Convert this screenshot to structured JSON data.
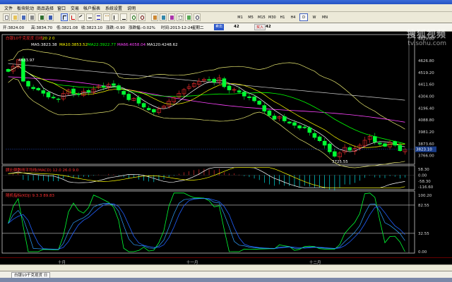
{
  "window": {
    "title": ""
  },
  "menu": [
    "文件",
    "板块轮动",
    "商品选择",
    "窗口",
    "交易",
    "帐户报表",
    "系统设置",
    "说明"
  ],
  "periods": [
    "M1",
    "M5",
    "M15",
    "M30",
    "H1",
    "H4",
    "D",
    "W",
    "MN"
  ],
  "active_period": "D",
  "info": {
    "open": "开:3824.00",
    "high": "高:3834.70",
    "low": "低:3821.08",
    "close": "收:3823.10",
    "change": "涨跌:-0.90",
    "change_pct": "涨跌幅:-0.02%",
    "time": "时间:2013-12-24",
    "weekday": "星期二",
    "bid_label": "卖出",
    "bid": "42",
    "ask_label": "买入",
    "ask": "42"
  },
  "watermark": {
    "main": "搜狐视频",
    "sub": "tv.sohu.com"
  },
  "chart_data": [
    {
      "type": "candlestick",
      "panel": "price",
      "title": "白银10千克现货 日线",
      "params": "20 2 0",
      "legend": [
        {
          "text": "MA5:3823.38",
          "color": "#ffffff"
        },
        {
          "text": "MA10:3853.52",
          "color": "#ffff00"
        },
        {
          "text": "MA22:3922.77",
          "color": "#00ff00"
        },
        {
          "text": "MA66:4058.04",
          "color": "#ff44ff"
        },
        {
          "text": "MA120:4248.62",
          "color": "#ffffff"
        }
      ],
      "y_ticks": [
        "4829.00",
        "4626.80",
        "4519.20",
        "4411.60",
        "4304.00",
        "4196.40",
        "4088.80",
        "3981.20",
        "3873.60",
        "3766.00"
      ],
      "ylim": [
        3700,
        4850
      ],
      "annotations": [
        {
          "text": "4633.97",
          "value": 4634
        },
        {
          "text": "3725.55",
          "value": 3726
        }
      ],
      "current_price_label": "3823.10",
      "close_series": [
        4528,
        4575,
        4634,
        4440,
        4395,
        4372,
        4360,
        4330,
        4296,
        4288,
        4275,
        4330,
        4360,
        4325,
        4318,
        4350,
        4342,
        4370,
        4395,
        4388,
        4410,
        4402,
        4360,
        4320,
        4272,
        4285,
        4240,
        4205,
        4180,
        4160,
        4190,
        4215,
        4260,
        4290,
        4330,
        4365,
        4390,
        4420,
        4440,
        4458,
        4448,
        4432,
        4470,
        4390,
        4360,
        4365,
        4340,
        4305,
        4290,
        4262,
        4230,
        4168,
        4130,
        4095,
        4120,
        4080,
        4060,
        4040,
        4015,
        4018,
        3975,
        3930,
        3900,
        3860,
        3800,
        3760,
        3790,
        3840,
        3815,
        3830,
        3860,
        3905,
        3940,
        3890,
        3870,
        3850,
        3885,
        3860,
        3810,
        3823
      ]
    },
    {
      "type": "bar",
      "panel": "indicator1",
      "title": "顾比倒数线平均线(MACD) 12.0 26.0 9.0",
      "y_ticks": [
        "58.30",
        "0.00",
        "-58.30",
        "-116.60"
      ],
      "ylim": [
        -130,
        80
      ]
    },
    {
      "type": "line",
      "panel": "indicator2",
      "title": "随机指标(KDJ) 9.3.3 89.83",
      "y_ticks": [
        "100.20",
        "82.55",
        "32.55",
        "0.00"
      ],
      "ylim": [
        0,
        105
      ]
    }
  ],
  "date_axis": [
    "十月",
    "十一月",
    "十二月"
  ],
  "bottom_tab": {
    "label": "白银10千克现货 日"
  }
}
